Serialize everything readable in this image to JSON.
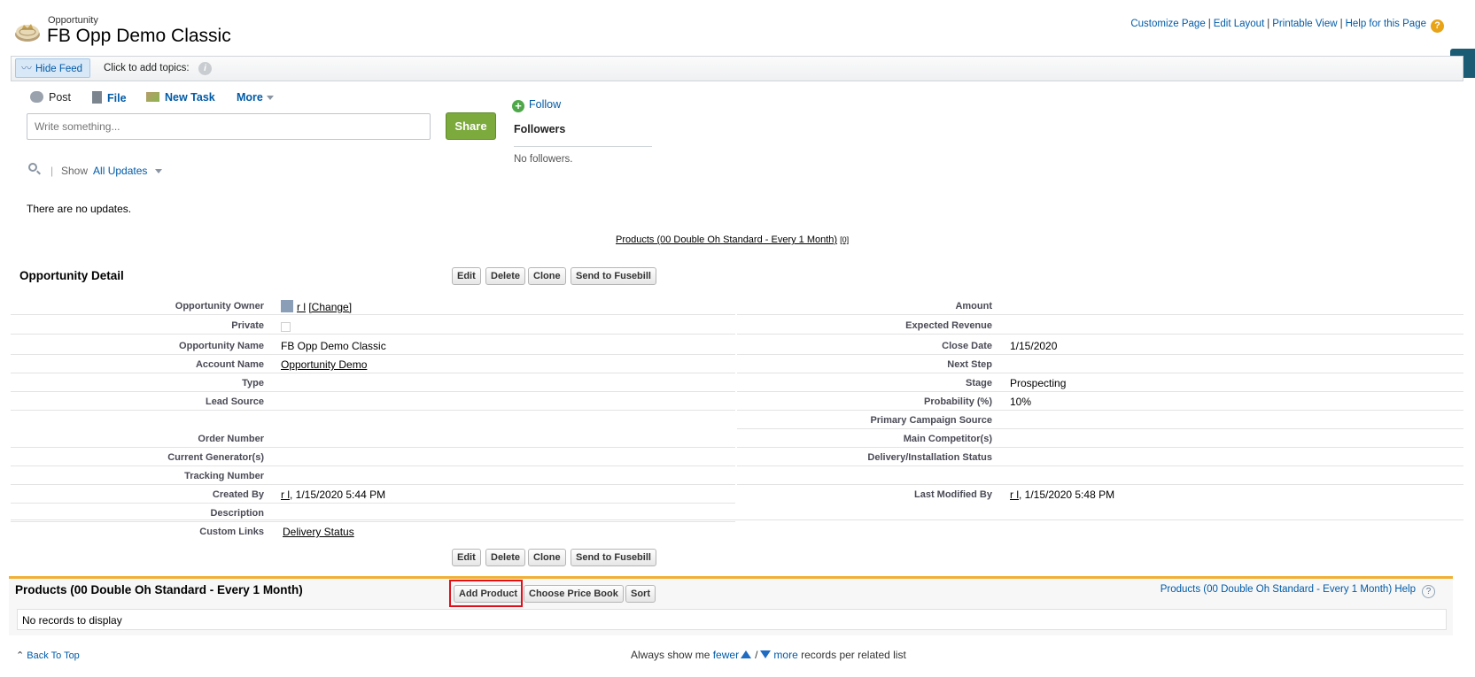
{
  "header": {
    "object_type": "Opportunity",
    "title": "FB Opp Demo Classic",
    "links": [
      "Customize Page",
      "Edit Layout",
      "Printable View",
      "Help for this Page"
    ]
  },
  "feed_bar": {
    "hide_feed": "Hide Feed",
    "topics": "Click to add topics:"
  },
  "publisher": {
    "tabs": [
      "Post",
      "File",
      "New Task",
      "More"
    ],
    "placeholder": "Write something...",
    "share": "Share",
    "show_label": "Show",
    "show_value": "All Updates",
    "no_updates": "There are no updates."
  },
  "followers": {
    "follow": "Follow",
    "heading": "Followers",
    "empty": "No followers."
  },
  "related_link": {
    "label": "Products (00 Double Oh Standard - Every 1 Month)",
    "count": "[0]"
  },
  "detail": {
    "heading": "Opportunity Detail",
    "buttons": [
      "Edit",
      "Delete",
      "Clone",
      "Send to Fusebill"
    ],
    "left": [
      {
        "label": "Opportunity Owner",
        "value": "r l",
        "extra": "[Change]"
      },
      {
        "label": "Private",
        "value": ""
      },
      {
        "label": "Opportunity Name",
        "value": "FB Opp Demo Classic"
      },
      {
        "label": "Account Name",
        "value": "Opportunity Demo"
      },
      {
        "label": "Type",
        "value": ""
      },
      {
        "label": "Lead Source",
        "value": ""
      },
      {
        "label": "",
        "value": ""
      },
      {
        "label": "Order Number",
        "value": ""
      },
      {
        "label": "Current Generator(s)",
        "value": ""
      },
      {
        "label": "Tracking Number",
        "value": ""
      },
      {
        "label": "Created By",
        "value": "r l",
        "extra": ", 1/15/2020 5:44 PM"
      },
      {
        "label": "Description",
        "value": ""
      },
      {
        "label": "Custom Links",
        "value": "Delivery Status"
      }
    ],
    "right": [
      {
        "label": "Amount",
        "value": ""
      },
      {
        "label": "Expected Revenue",
        "value": ""
      },
      {
        "label": "Close Date",
        "value": "1/15/2020"
      },
      {
        "label": "Next Step",
        "value": ""
      },
      {
        "label": "Stage",
        "value": "Prospecting"
      },
      {
        "label": "Probability (%)",
        "value": "10%"
      },
      {
        "label": "Primary Campaign Source",
        "value": ""
      },
      {
        "label": "Main Competitor(s)",
        "value": ""
      },
      {
        "label": "Delivery/Installation Status",
        "value": ""
      },
      {
        "label": "",
        "value": ""
      },
      {
        "label": "Last Modified By",
        "value": "r l",
        "extra": ", 1/15/2020 5:48 PM"
      }
    ]
  },
  "products": {
    "heading": "Products (00 Double Oh Standard - Every 1 Month)",
    "buttons": [
      "Add Product",
      "Choose Price Book",
      "Sort"
    ],
    "help": "Products (00 Double Oh Standard - Every 1 Month) Help",
    "empty": "No records to display"
  },
  "footer": {
    "back_to_top": "Back To Top",
    "always_show": "Always show me",
    "fewer": "fewer",
    "slash": "/",
    "more": "more",
    "records_per": "records per related list"
  }
}
